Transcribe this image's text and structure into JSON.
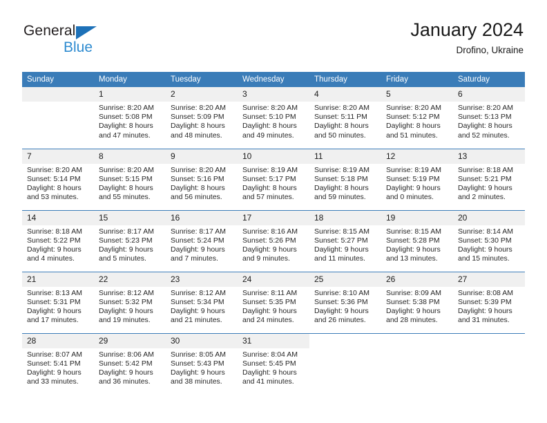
{
  "brand": {
    "name_part1": "General",
    "name_part2": "Blue",
    "triangle_color": "#1d71b8",
    "blue_color": "#2e8bd0"
  },
  "header": {
    "title": "January 2024",
    "subtitle": "Drofino, Ukraine"
  },
  "theme": {
    "header_blue": "#3a7cb8",
    "daynum_bg": "#f0f0f0",
    "text": "#262626"
  },
  "calendar": {
    "weekday_headers": [
      "Sunday",
      "Monday",
      "Tuesday",
      "Wednesday",
      "Thursday",
      "Friday",
      "Saturday"
    ],
    "weeks": [
      [
        {
          "day": "",
          "empty": true,
          "lines": []
        },
        {
          "day": "1",
          "lines": [
            "Sunrise: 8:20 AM",
            "Sunset: 5:08 PM",
            "Daylight: 8 hours",
            "and 47 minutes."
          ]
        },
        {
          "day": "2",
          "lines": [
            "Sunrise: 8:20 AM",
            "Sunset: 5:09 PM",
            "Daylight: 8 hours",
            "and 48 minutes."
          ]
        },
        {
          "day": "3",
          "lines": [
            "Sunrise: 8:20 AM",
            "Sunset: 5:10 PM",
            "Daylight: 8 hours",
            "and 49 minutes."
          ]
        },
        {
          "day": "4",
          "lines": [
            "Sunrise: 8:20 AM",
            "Sunset: 5:11 PM",
            "Daylight: 8 hours",
            "and 50 minutes."
          ]
        },
        {
          "day": "5",
          "lines": [
            "Sunrise: 8:20 AM",
            "Sunset: 5:12 PM",
            "Daylight: 8 hours",
            "and 51 minutes."
          ]
        },
        {
          "day": "6",
          "lines": [
            "Sunrise: 8:20 AM",
            "Sunset: 5:13 PM",
            "Daylight: 8 hours",
            "and 52 minutes."
          ]
        }
      ],
      [
        {
          "day": "7",
          "lines": [
            "Sunrise: 8:20 AM",
            "Sunset: 5:14 PM",
            "Daylight: 8 hours",
            "and 53 minutes."
          ]
        },
        {
          "day": "8",
          "lines": [
            "Sunrise: 8:20 AM",
            "Sunset: 5:15 PM",
            "Daylight: 8 hours",
            "and 55 minutes."
          ]
        },
        {
          "day": "9",
          "lines": [
            "Sunrise: 8:20 AM",
            "Sunset: 5:16 PM",
            "Daylight: 8 hours",
            "and 56 minutes."
          ]
        },
        {
          "day": "10",
          "lines": [
            "Sunrise: 8:19 AM",
            "Sunset: 5:17 PM",
            "Daylight: 8 hours",
            "and 57 minutes."
          ]
        },
        {
          "day": "11",
          "lines": [
            "Sunrise: 8:19 AM",
            "Sunset: 5:18 PM",
            "Daylight: 8 hours",
            "and 59 minutes."
          ]
        },
        {
          "day": "12",
          "lines": [
            "Sunrise: 8:19 AM",
            "Sunset: 5:19 PM",
            "Daylight: 9 hours",
            "and 0 minutes."
          ]
        },
        {
          "day": "13",
          "lines": [
            "Sunrise: 8:18 AM",
            "Sunset: 5:21 PM",
            "Daylight: 9 hours",
            "and 2 minutes."
          ]
        }
      ],
      [
        {
          "day": "14",
          "lines": [
            "Sunrise: 8:18 AM",
            "Sunset: 5:22 PM",
            "Daylight: 9 hours",
            "and 4 minutes."
          ]
        },
        {
          "day": "15",
          "lines": [
            "Sunrise: 8:17 AM",
            "Sunset: 5:23 PM",
            "Daylight: 9 hours",
            "and 5 minutes."
          ]
        },
        {
          "day": "16",
          "lines": [
            "Sunrise: 8:17 AM",
            "Sunset: 5:24 PM",
            "Daylight: 9 hours",
            "and 7 minutes."
          ]
        },
        {
          "day": "17",
          "lines": [
            "Sunrise: 8:16 AM",
            "Sunset: 5:26 PM",
            "Daylight: 9 hours",
            "and 9 minutes."
          ]
        },
        {
          "day": "18",
          "lines": [
            "Sunrise: 8:15 AM",
            "Sunset: 5:27 PM",
            "Daylight: 9 hours",
            "and 11 minutes."
          ]
        },
        {
          "day": "19",
          "lines": [
            "Sunrise: 8:15 AM",
            "Sunset: 5:28 PM",
            "Daylight: 9 hours",
            "and 13 minutes."
          ]
        },
        {
          "day": "20",
          "lines": [
            "Sunrise: 8:14 AM",
            "Sunset: 5:30 PM",
            "Daylight: 9 hours",
            "and 15 minutes."
          ]
        }
      ],
      [
        {
          "day": "21",
          "lines": [
            "Sunrise: 8:13 AM",
            "Sunset: 5:31 PM",
            "Daylight: 9 hours",
            "and 17 minutes."
          ]
        },
        {
          "day": "22",
          "lines": [
            "Sunrise: 8:12 AM",
            "Sunset: 5:32 PM",
            "Daylight: 9 hours",
            "and 19 minutes."
          ]
        },
        {
          "day": "23",
          "lines": [
            "Sunrise: 8:12 AM",
            "Sunset: 5:34 PM",
            "Daylight: 9 hours",
            "and 21 minutes."
          ]
        },
        {
          "day": "24",
          "lines": [
            "Sunrise: 8:11 AM",
            "Sunset: 5:35 PM",
            "Daylight: 9 hours",
            "and 24 minutes."
          ]
        },
        {
          "day": "25",
          "lines": [
            "Sunrise: 8:10 AM",
            "Sunset: 5:36 PM",
            "Daylight: 9 hours",
            "and 26 minutes."
          ]
        },
        {
          "day": "26",
          "lines": [
            "Sunrise: 8:09 AM",
            "Sunset: 5:38 PM",
            "Daylight: 9 hours",
            "and 28 minutes."
          ]
        },
        {
          "day": "27",
          "lines": [
            "Sunrise: 8:08 AM",
            "Sunset: 5:39 PM",
            "Daylight: 9 hours",
            "and 31 minutes."
          ]
        }
      ],
      [
        {
          "day": "28",
          "lines": [
            "Sunrise: 8:07 AM",
            "Sunset: 5:41 PM",
            "Daylight: 9 hours",
            "and 33 minutes."
          ]
        },
        {
          "day": "29",
          "lines": [
            "Sunrise: 8:06 AM",
            "Sunset: 5:42 PM",
            "Daylight: 9 hours",
            "and 36 minutes."
          ]
        },
        {
          "day": "30",
          "lines": [
            "Sunrise: 8:05 AM",
            "Sunset: 5:43 PM",
            "Daylight: 9 hours",
            "and 38 minutes."
          ]
        },
        {
          "day": "31",
          "lines": [
            "Sunrise: 8:04 AM",
            "Sunset: 5:45 PM",
            "Daylight: 9 hours",
            "and 41 minutes."
          ]
        },
        {
          "day": "",
          "emptytail": true,
          "lines": []
        },
        {
          "day": "",
          "emptytail": true,
          "lines": []
        },
        {
          "day": "",
          "emptytail": true,
          "lines": []
        }
      ]
    ]
  }
}
